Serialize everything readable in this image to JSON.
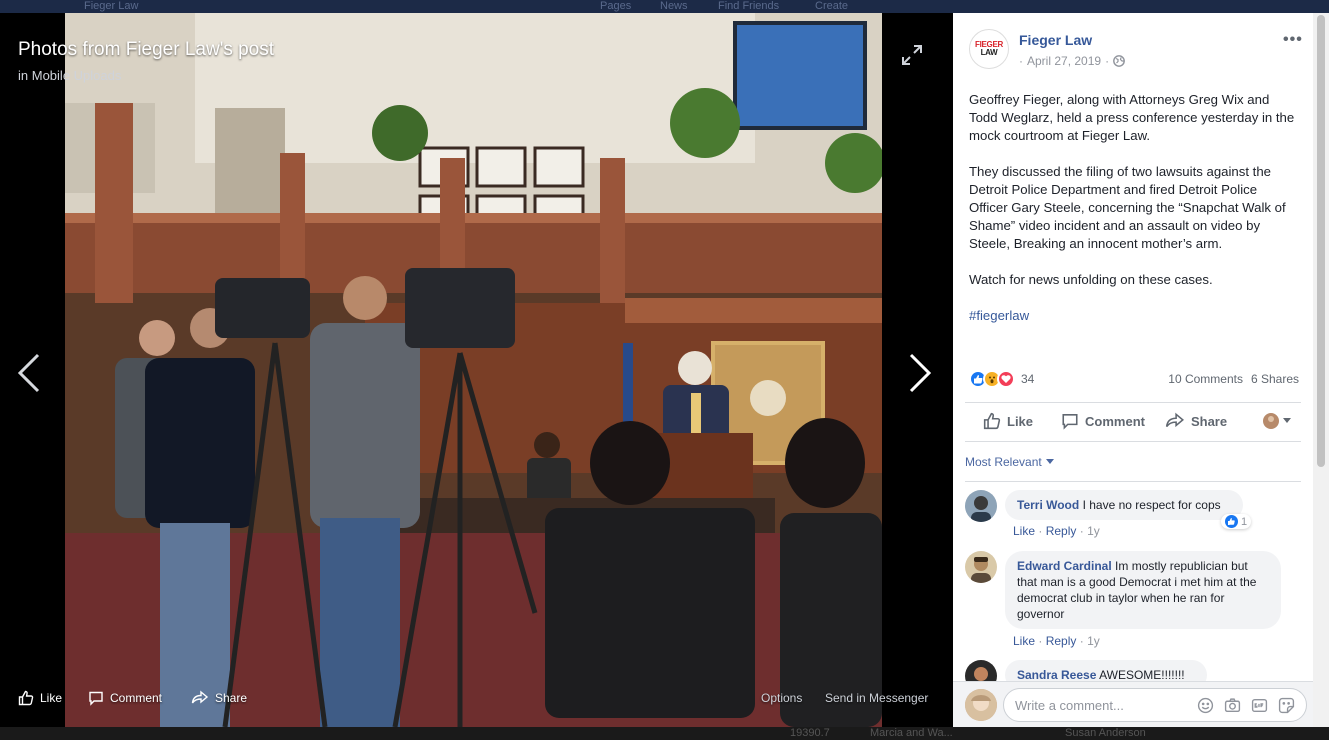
{
  "background": {
    "top_ghost": [
      "Fieger Law",
      "Pages",
      "News",
      "Find Friends",
      "Create"
    ],
    "bottom_ghost": [
      "19390.7",
      "Marcia and Wa...",
      "Susan Anderson"
    ]
  },
  "stage": {
    "title": "Photos from Fieger Law's post",
    "subtitle_prefix": "in",
    "subtitle_album": "Mobile Uploads",
    "actions": {
      "like": "Like",
      "comment": "Comment",
      "share": "Share",
      "options": "Options",
      "send": "Send in Messenger"
    },
    "icons": {
      "expand": "expand-icon",
      "prev": "chevron-left-icon",
      "next": "chevron-right-icon"
    }
  },
  "post": {
    "logo_line1": "FIEGER",
    "logo_line2": "LAW",
    "page_name": "Fieger Law",
    "date": "April 27, 2019",
    "date_sep": "·",
    "more": "•••",
    "paragraphs": [
      "Geoffrey Fieger, along with Attorneys Greg Wix and Todd Weglarz, held a press conference yesterday in the mock courtroom at Fieger Law.",
      "They discussed the filing of two lawsuits against the Detroit Police Department and fired Detroit Police Officer Gary Steele, concerning the “Snapchat Walk of Shame” video incident and an assault on video by Steele, Breaking an innocent mother’s arm.",
      "Watch for news unfolding on these cases."
    ],
    "hashtag": "#fiegerlaw",
    "reaction_count": "34",
    "comments_count": "10 Comments",
    "shares_count": "6 Shares",
    "action_like": "Like",
    "action_comment": "Comment",
    "action_share": "Share",
    "sort_label": "Most Relevant",
    "colors": {
      "link": "#365899",
      "like": "#1877f2",
      "wow": "#f7b125",
      "love": "#f33e58"
    }
  },
  "comments": [
    {
      "name": "Terri Wood",
      "text": "I have no respect for cops",
      "like": "Like",
      "reply": "Reply",
      "time": "1y",
      "likes": "1"
    },
    {
      "name": "Edward Cardinal",
      "text": "Im mostly republician but that man is a good Democrat i met him at the democrat club in taylor when he ran for governor",
      "like": "Like",
      "reply": "Reply",
      "time": "1y"
    },
    {
      "name": "Sandra Reese",
      "text": "AWESOME!!!!!!!"
    }
  ],
  "composer": {
    "placeholder": "Write a comment..."
  }
}
